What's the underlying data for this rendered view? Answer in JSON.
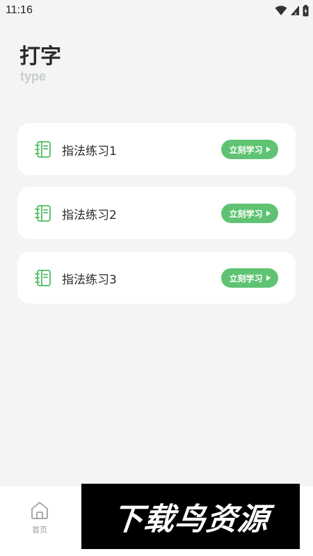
{
  "status_bar": {
    "time": "11:16",
    "icons": [
      "wifi-icon",
      "signal-icon",
      "battery-icon"
    ]
  },
  "header": {
    "title": "打字",
    "subtitle": "type"
  },
  "cards": [
    {
      "label": "指法练习1",
      "button_label": "立刻学习",
      "icon": "notebook-icon"
    },
    {
      "label": "指法练习2",
      "button_label": "立刻学习",
      "icon": "notebook-icon"
    },
    {
      "label": "指法练习3",
      "button_label": "立刻学习",
      "icon": "notebook-icon"
    }
  ],
  "bottom_nav": {
    "items": [
      {
        "label": "首页",
        "icon": "home-icon"
      }
    ]
  },
  "watermark": {
    "text": "下载鸟资源"
  },
  "colors": {
    "accent": "#5fc373",
    "background": "#f3f5f4",
    "card": "#ffffff",
    "subtitle": "#c9cccb"
  }
}
